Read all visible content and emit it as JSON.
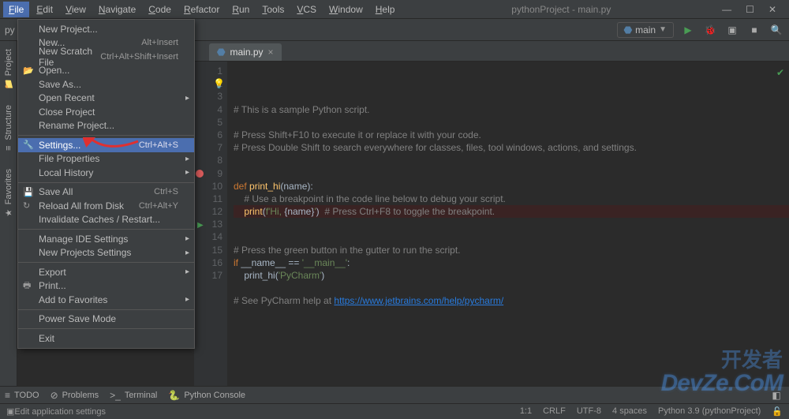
{
  "window": {
    "title": "pythonProject - main.py"
  },
  "menubar": [
    "File",
    "Edit",
    "View",
    "Navigate",
    "Code",
    "Refactor",
    "Run",
    "Tools",
    "VCS",
    "Window",
    "Help"
  ],
  "breadcrumb": "py",
  "run_config": {
    "name": "main"
  },
  "file_menu": [
    {
      "label": "New Project...",
      "type": "item"
    },
    {
      "label": "New...",
      "shortcut": "Alt+Insert",
      "type": "item"
    },
    {
      "label": "New Scratch File",
      "shortcut": "Ctrl+Alt+Shift+Insert",
      "type": "item"
    },
    {
      "label": "Open...",
      "icon": "📂",
      "type": "item"
    },
    {
      "label": "Save As...",
      "type": "item"
    },
    {
      "label": "Open Recent",
      "arrow": true,
      "type": "item"
    },
    {
      "label": "Close Project",
      "type": "item"
    },
    {
      "label": "Rename Project...",
      "type": "item"
    },
    {
      "type": "sep"
    },
    {
      "label": "Settings...",
      "shortcut": "Ctrl+Alt+S",
      "icon": "🔧",
      "type": "item",
      "highlight": true
    },
    {
      "label": "File Properties",
      "arrow": true,
      "type": "item"
    },
    {
      "label": "Local History",
      "arrow": true,
      "type": "item"
    },
    {
      "type": "sep"
    },
    {
      "label": "Save All",
      "shortcut": "Ctrl+S",
      "icon": "💾",
      "type": "item"
    },
    {
      "label": "Reload All from Disk",
      "shortcut": "Ctrl+Alt+Y",
      "icon": "↻",
      "type": "item"
    },
    {
      "label": "Invalidate Caches / Restart...",
      "type": "item"
    },
    {
      "type": "sep"
    },
    {
      "label": "Manage IDE Settings",
      "arrow": true,
      "type": "item"
    },
    {
      "label": "New Projects Settings",
      "arrow": true,
      "type": "item"
    },
    {
      "type": "sep"
    },
    {
      "label": "Export",
      "arrow": true,
      "type": "item"
    },
    {
      "label": "Print...",
      "icon": "🖶",
      "type": "item"
    },
    {
      "label": "Add to Favorites",
      "arrow": true,
      "type": "item"
    },
    {
      "type": "sep"
    },
    {
      "label": "Power Save Mode",
      "type": "item"
    },
    {
      "type": "sep"
    },
    {
      "label": "Exit",
      "type": "item"
    }
  ],
  "editor_tab": {
    "name": "main.py"
  },
  "left_tabs": [
    "Project",
    "Structure",
    "Favorites"
  ],
  "code_lines": [
    {
      "n": 1,
      "html": "<span class='c-cmt'># This is a sample Python script.</span>"
    },
    {
      "n": 2,
      "html": "",
      "bulb": true
    },
    {
      "n": 3,
      "html": "<span class='c-cmt'># Press Shift+F10 to execute it or replace it with your code.</span>"
    },
    {
      "n": 4,
      "html": "<span class='c-cmt'># Press Double Shift to search everywhere for classes, files, tool windows, actions, and settings.</span>"
    },
    {
      "n": 5,
      "html": ""
    },
    {
      "n": 6,
      "html": ""
    },
    {
      "n": 7,
      "html": "<span class='c-kw'>def</span> <span class='c-fn'>print_hi</span>(name):"
    },
    {
      "n": 8,
      "html": "    <span class='c-cmt'># Use a breakpoint in the code line below to debug your script.</span>"
    },
    {
      "n": 9,
      "html": "    <span class='c-fn'>print</span>(<span class='c-str'>f'Hi, </span>{name}<span class='c-str'>'</span>)  <span class='c-cmt'># Press Ctrl+F8 to toggle the breakpoint.</span>",
      "hl": true,
      "bp": true
    },
    {
      "n": 10,
      "html": ""
    },
    {
      "n": 11,
      "html": ""
    },
    {
      "n": 12,
      "html": "<span class='c-cmt'># Press the green button in the gutter to run the script.</span>"
    },
    {
      "n": 13,
      "html": "<span class='c-kw'>if</span> __name__ == <span class='c-str'>'__main__'</span>:",
      "run": true
    },
    {
      "n": 14,
      "html": "    print_hi(<span class='c-str'>'PyCharm'</span>)"
    },
    {
      "n": 15,
      "html": ""
    },
    {
      "n": 16,
      "html": "<span class='c-cmt'># See PyCharm help at <span class='c-lnk'>https://www.jetbrains.com/help/pycharm/</span></span>"
    },
    {
      "n": 17,
      "html": ""
    }
  ],
  "bottom_tabs": [
    {
      "icon": "≡",
      "label": "TODO"
    },
    {
      "icon": "⊘",
      "label": "Problems"
    },
    {
      "icon": ">_",
      "label": "Terminal"
    },
    {
      "icon": "🐍",
      "label": "Python Console"
    }
  ],
  "status": {
    "left": "  Edit application settings",
    "pos": "1:1",
    "crlf": "CRLF",
    "enc": "UTF-8",
    "indent": "4 spaces",
    "interp": "Python 3.9 (pythonProject)",
    "lock": "🔓"
  },
  "watermark": {
    "cn": "开发者",
    "en": "DevZe.CoM"
  }
}
